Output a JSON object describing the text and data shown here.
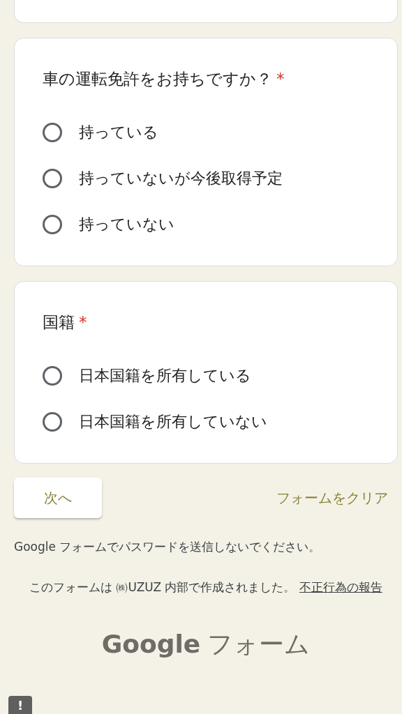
{
  "questions": [
    {
      "title": "車の運転免許をお持ちですか？",
      "required": true,
      "options": [
        {
          "label": "持っている",
          "selected": false
        },
        {
          "label": "持っていないが今後取得予定",
          "selected": false
        },
        {
          "label": "持っていない",
          "selected": false
        }
      ]
    },
    {
      "title": "国籍",
      "required": true,
      "options": [
        {
          "label": "日本国籍を所有している",
          "selected": false
        },
        {
          "label": "日本国籍を所有していない",
          "selected": false
        }
      ]
    }
  ],
  "required_mark": "*",
  "next_button": "次へ",
  "clear_button": "フォームをクリア",
  "password_notice": "Google フォームでパスワードを送信しないでください。",
  "owner_notice": "このフォームは ㈱UZUZ 内部で作成されました。",
  "report_link": "不正行為の報告",
  "logo": {
    "brand": "Google",
    "product": "フォーム"
  },
  "feedback_icon": "!"
}
